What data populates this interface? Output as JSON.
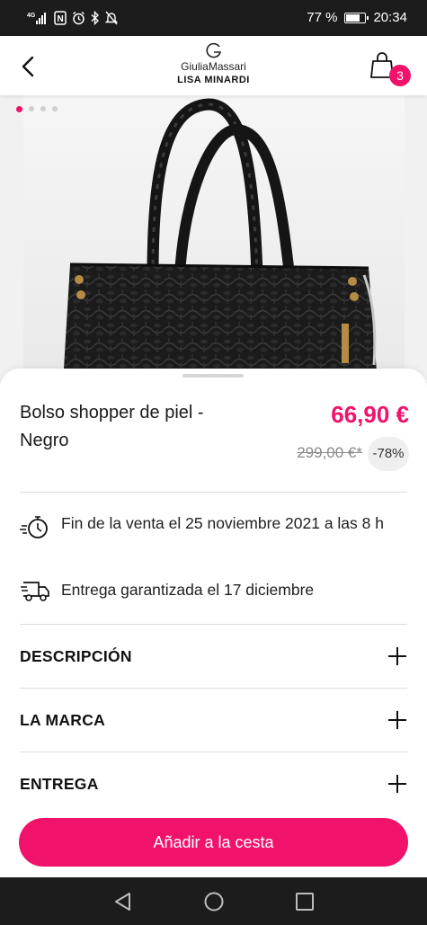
{
  "status_bar": {
    "network": "4G",
    "nfc": "N",
    "battery_percent": "77 %",
    "battery_level": 0.77,
    "time": "20:34",
    "icons": [
      "signal-icon",
      "nfc-icon",
      "alarm-icon",
      "bluetooth-icon",
      "mute-icon",
      "battery-icon"
    ]
  },
  "header": {
    "brand_name": "GiuliaMassari",
    "brand_sub": "LISA MINARDI",
    "cart_count": "3",
    "accent_color": "#f0126b"
  },
  "gallery": {
    "image_count": 4,
    "active_index": 0
  },
  "product": {
    "title": "Bolso shopper de piel - Negro",
    "price": "66,90 €",
    "old_price": "299,00 €*",
    "discount": "-78%"
  },
  "info": {
    "sale_end": "Fin de la venta el 25 noviembre 2021 a las 8 h",
    "delivery": "Entrega garantizada el 17 diciembre"
  },
  "sections": [
    {
      "label": "DESCRIPCIÓN"
    },
    {
      "label": "LA MARCA"
    },
    {
      "label": "ENTREGA"
    }
  ],
  "cta": {
    "label": "Añadir a la cesta"
  }
}
